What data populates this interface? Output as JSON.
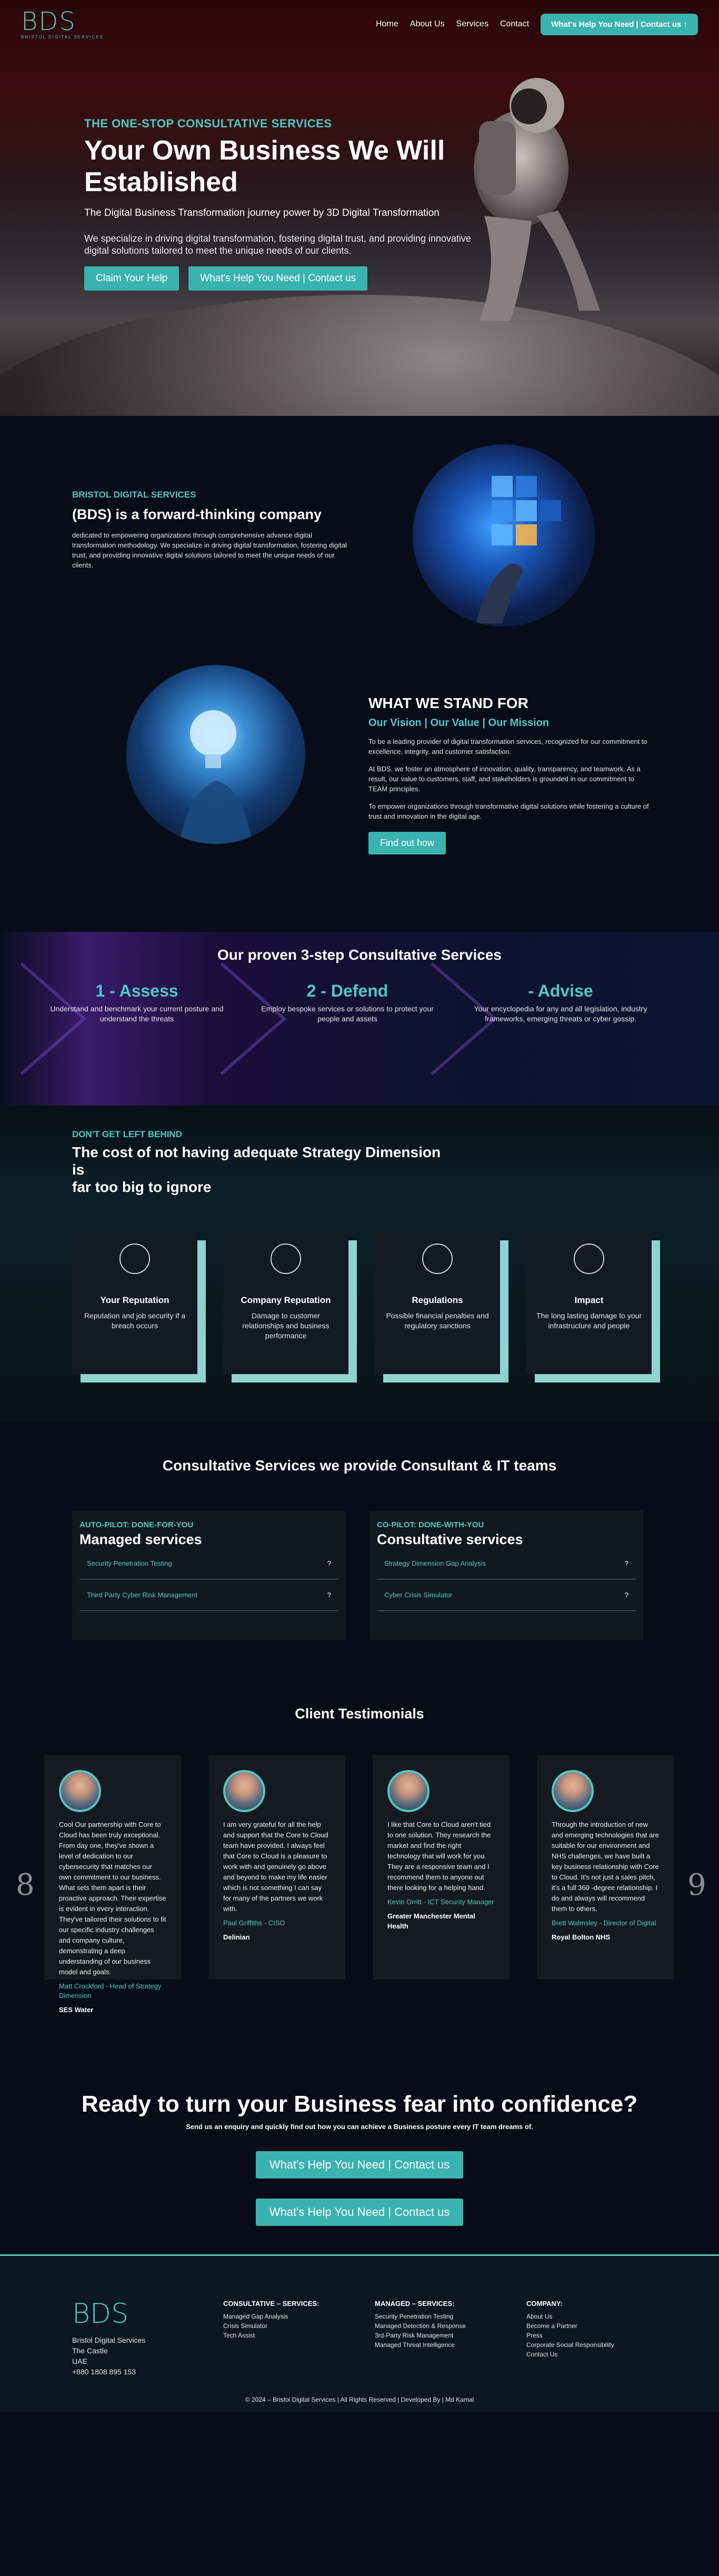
{
  "nav": {
    "logo_mark": "BDS",
    "logo_sub": "BRISTOL DIGITAL SERVICES",
    "links": [
      "Home",
      "About Us",
      "Services",
      "Contact"
    ],
    "cta": "What's Help You Need | Contact us ↑"
  },
  "hero": {
    "kicker": "THE ONE-STOP CONSULTATIVE SERVICES",
    "title_line1": "Your Own Business We Will",
    "title_line2": "Established",
    "tagline": "The Digital Business Transformation journey power by 3D Digital Transformation",
    "desc": "We specialize in driving digital transformation, fostering digital trust, and providing innovative digital solutions tailored to meet the unique needs of our clients.",
    "btn1": "Claim Your Help",
    "btn2": "What's Help You Need | Contact us"
  },
  "about": {
    "kicker": "BRISTOL DIGITAL SERVICES",
    "title": "(BDS) is a forward-thinking company",
    "desc": "dedicated to empowering organizations through comprehensive advance digital transformation methodology. We specialize in driving digital transformation, fostering digital trust, and providing innovative digital solutions tailored to meet the unique needs of our clients."
  },
  "stand": {
    "title": "WHAT WE STAND FOR",
    "subtitle": "Our Vision | Our Value | Our Mission",
    "p1": "To be a leading provider of digital transformation services, recognized for our commitment to excellence, integrity, and customer satisfaction.",
    "p2": "At BDS, we foster an atmosphere of innovation, quality, transparency, and teamwork. As a result, our value to customers, staff, and stakeholders is grounded in our commitment to TEAM principles.",
    "p3": "To empower organizations through transformative digital solutions while fostering a culture of trust and innovation in the digital age.",
    "btn": "Find out how"
  },
  "steps": {
    "title": "Our proven 3-step Consultative Services",
    "items": [
      {
        "t": "1 - Assess",
        "d": "Understand and benchmark your current posture and understand the threats"
      },
      {
        "t": "2 - Defend",
        "d": "Employ bespoke services or solutions to protect your people and assets"
      },
      {
        "t": "- Advise",
        "d": "Your encyclopedia for any and all legislation, industry frameworks, emerging threats or cyber gossip."
      }
    ]
  },
  "cost": {
    "kicker": "DON'T GET LEFT BEHIND",
    "title_l1": "The cost of not having adequate Strategy Dimension",
    "title_l2": "is",
    "title_l3": "far too big to ignore",
    "cards": [
      {
        "t": "Your Reputation",
        "d": "Reputation and job security if a breach occurs"
      },
      {
        "t": "Company Reputation",
        "d": "Damage to customer relationships and business performance"
      },
      {
        "t": "Regulations",
        "d": "Possible financial penalties and regulatory sanctions"
      },
      {
        "t": "Impact",
        "d": "The long lasting damage to your infrastructure and people"
      }
    ]
  },
  "services": {
    "title": "Consultative Services we provide Consultant & IT teams",
    "left": {
      "k": "AUTO-PILOT: DONE-FOR-YOU",
      "t": "Managed services",
      "rows": [
        "Security Penetration Testing",
        "Third Party Cyber Risk Management"
      ]
    },
    "right": {
      "k": "CO-PILOT: DONE-WITH-YOU",
      "t": "Consultative services",
      "rows": [
        "Strategy Dimension Gap Analysis",
        "Cyber Crisis Simulator"
      ]
    },
    "q": "?"
  },
  "testimonials": {
    "title": "Client Testimonials",
    "prev": "8",
    "next": "9",
    "items": [
      {
        "q": "Cool Our partnership with Core to Cloud has been truly exceptional. From day one, they've shown a level of dedication to our cybersecurity that matches our own commitment to our business. What sets them apart is their proactive approach. Their expertise is evident in every interaction. They've tailored their solutions to fit our specific industry challenges and company culture, demonstrating a deep understanding of our business model and goals.",
        "n": "Matt Crockford - Head of Strategy Dimension",
        "c": "SES Water"
      },
      {
        "q": "I am very grateful for all the help and support that the Core to Cloud team have provided. I always feel that Core to Cloud is a pleasure to work with and genuinely go above and beyond to make my life easier which is not something I can say for many of the partners we work with.",
        "n": "Paul Griffiths - CISO",
        "c": "Delinian"
      },
      {
        "q": "I like that Core to Cloud aren't tied to one solution. They research the market and find the right technology that will work for you. They are a responsive team and I recommend them to anyone out there looking for a helping hand.",
        "n": "Kevin Orritt - ICT Security Manager",
        "c": "Greater Manchester Mental Health"
      },
      {
        "q": "Through the introduction of new and emerging technologies that are suitable for our environment and NHS challenges, we have built a key business relationship with Core to Cloud. It's not just a sales pitch, it's a full 360 -degree relationship. I do and always will recommend them to others.",
        "n": "Brett Walmsley - Director of Digital",
        "c": "Royal Bolton NHS"
      }
    ]
  },
  "ready": {
    "title": "Ready to turn your Business fear into confidence?",
    "sub": "Send us an enquiry and quickly find out how you can achieve a Business posture every IT team dreams of.",
    "btn1": "What's Help You Need | Contact us",
    "btn2": "What's Help You Need | Contact us"
  },
  "footer": {
    "logo": "BDS",
    "addr": [
      "Bristol Digital Services",
      "The Castle",
      "UAE",
      "+880 1808 895 153"
    ],
    "cols": [
      {
        "h": "CONSULTATIVE – SERVICES:",
        "items": [
          "Managed Gap Analysis",
          "Crisis Simulator",
          "Tech Assist"
        ]
      },
      {
        "h": "MANAGED – SERVICES:",
        "items": [
          "Security Penetration Testing",
          "Managed Detection & Response",
          "3rd-Party Risk Management",
          "Managed Threat Intelligence"
        ]
      },
      {
        "h": "COMPANY:",
        "items": [
          "About Us",
          "Become a Partner",
          "Press",
          "Corporate Social Responsibility",
          "Contact Us"
        ]
      }
    ],
    "copy": "© 2024 – Bristol Digital Services | All Rights Reserved | Developed By | Md Kamal"
  }
}
